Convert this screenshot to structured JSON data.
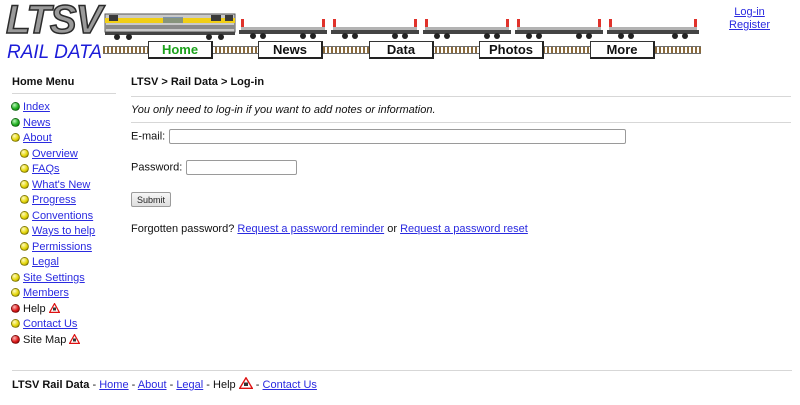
{
  "header": {
    "logo_text": "LTSV",
    "logo_subtext": "RAIL DATA",
    "nav": [
      "Home",
      "News",
      "Data",
      "Photos",
      "More"
    ],
    "active_nav": "Home",
    "login_link": "Log-in",
    "register_link": "Register"
  },
  "sidebar": {
    "title": "Home Menu",
    "items": [
      {
        "label": "Index",
        "dot": "green",
        "level": 1,
        "link": true,
        "warn": false
      },
      {
        "label": "News",
        "dot": "green",
        "level": 1,
        "link": true,
        "warn": false
      },
      {
        "label": "About",
        "dot": "yellow",
        "level": 1,
        "link": true,
        "warn": false
      },
      {
        "label": "Overview",
        "dot": "yellow",
        "level": 2,
        "link": true,
        "warn": false
      },
      {
        "label": "FAQs",
        "dot": "yellow",
        "level": 2,
        "link": true,
        "warn": false
      },
      {
        "label": "What's New",
        "dot": "yellow",
        "level": 2,
        "link": true,
        "warn": false
      },
      {
        "label": "Progress",
        "dot": "yellow",
        "level": 2,
        "link": true,
        "warn": false
      },
      {
        "label": "Conventions",
        "dot": "yellow",
        "level": 2,
        "link": true,
        "warn": false
      },
      {
        "label": "Ways to help",
        "dot": "yellow",
        "level": 2,
        "link": true,
        "warn": false
      },
      {
        "label": "Permissions",
        "dot": "yellow",
        "level": 2,
        "link": true,
        "warn": false
      },
      {
        "label": "Legal",
        "dot": "yellow",
        "level": 2,
        "link": true,
        "warn": false
      },
      {
        "label": "Site Settings",
        "dot": "yellow",
        "level": 1,
        "link": true,
        "warn": false
      },
      {
        "label": "Members",
        "dot": "yellow",
        "level": 1,
        "link": true,
        "warn": false
      },
      {
        "label": "Help",
        "dot": "red",
        "level": 1,
        "link": false,
        "warn": true
      },
      {
        "label": "Contact Us",
        "dot": "yellow",
        "level": 1,
        "link": true,
        "warn": false
      },
      {
        "label": "Site Map",
        "dot": "red",
        "level": 1,
        "link": false,
        "warn": true
      }
    ]
  },
  "main": {
    "breadcrumb": "LTSV > Rail Data > Log-in",
    "intro": "You only need to log-in if you want to add notes or information.",
    "email_label": "E-mail:",
    "email_value": "",
    "password_label": "Password:",
    "password_value": "",
    "submit_label": "Submit",
    "forgot_text": "Forgotten password?",
    "reminder_link": "Request a password reminder",
    "or_text": "or",
    "reset_link": "Request a password reset"
  },
  "footer": {
    "brand": "LTSV Rail Data",
    "sep": "-",
    "links": [
      "Home",
      "About",
      "Legal"
    ],
    "help": "Help",
    "contact": "Contact Us"
  },
  "colors": {
    "link": "#2a2ae0",
    "active_nav": "#1aa11a",
    "logo_blue": "#1c1cd8",
    "dot_green": "#21b121",
    "dot_yellow": "#e5d70a",
    "dot_red": "#dd1a1a"
  }
}
